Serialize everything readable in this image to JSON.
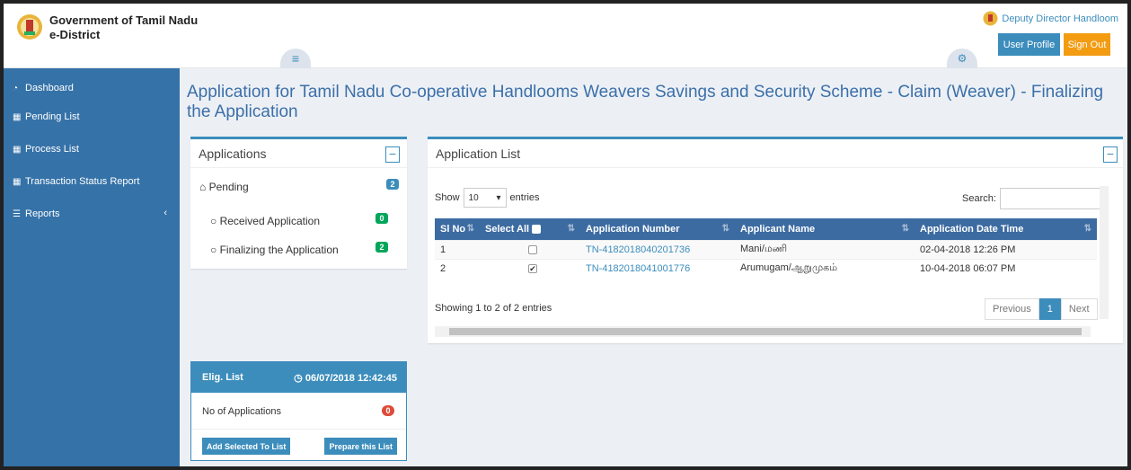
{
  "header": {
    "org_title": "Government of Tamil Nadu",
    "org_sub": "e-District",
    "user_name": "Deputy Director Handloom",
    "profile_label": "User Profile",
    "signout_label": "Sign Out",
    "menu_toggle_icon": "hamburger-icon",
    "settings_icon": "gears-icon"
  },
  "sidebar": {
    "items": [
      {
        "label": "Dashboard",
        "icon": "dashboard-icon"
      },
      {
        "label": "Pending List",
        "icon": "th-icon"
      },
      {
        "label": "Process List",
        "icon": "th-icon"
      },
      {
        "label": "Transaction Status Report",
        "icon": "th-icon"
      },
      {
        "label": "Reports",
        "icon": "list-icon"
      }
    ]
  },
  "page_title": "Application for Tamil Nadu Co-operative Handlooms Weavers Savings and Security Scheme - Claim (Weaver) - Finalizing the Application",
  "applications": {
    "title": "Applications",
    "pending_label": "Pending",
    "pending_count": "2",
    "received_label": "Received Application",
    "received_count": "0",
    "finalizing_label": "Finalizing the Application",
    "finalizing_count": "2"
  },
  "app_list": {
    "title": "Application List",
    "show_label": "Show",
    "entries_value": "10",
    "entries_label": "entries",
    "search_label": "Search:",
    "columns": [
      "Sl No",
      "Select All",
      "Application Number",
      "Applicant Name",
      "Application Date Time"
    ],
    "rows": [
      {
        "sl": "1",
        "checked": false,
        "number": "TN-4182018040201736",
        "name": "Mani/மணி",
        "date": "02-04-2018 12:26 PM"
      },
      {
        "sl": "2",
        "checked": true,
        "number": "TN-4182018041001776",
        "name": "Arumugam/ஆறுமுகம்",
        "date": "10-04-2018 06:07 PM"
      }
    ],
    "showing": "Showing 1 to 2 of 2 entries",
    "prev_label": "Previous",
    "page_label": "1",
    "next_label": "Next"
  },
  "elig": {
    "title": "Elig. List",
    "time": "06/07/2018 12:42:45",
    "no_apps_label": "No of Applications",
    "no_apps_count": "0",
    "add_label": "Add Selected To List",
    "prepare_label": "Prepare this List"
  },
  "colors": {
    "sidebar_bg": "#3572a8",
    "accent": "#3c8dbc",
    "signout": "#f39c12",
    "table_head": "#3c6ba2"
  }
}
